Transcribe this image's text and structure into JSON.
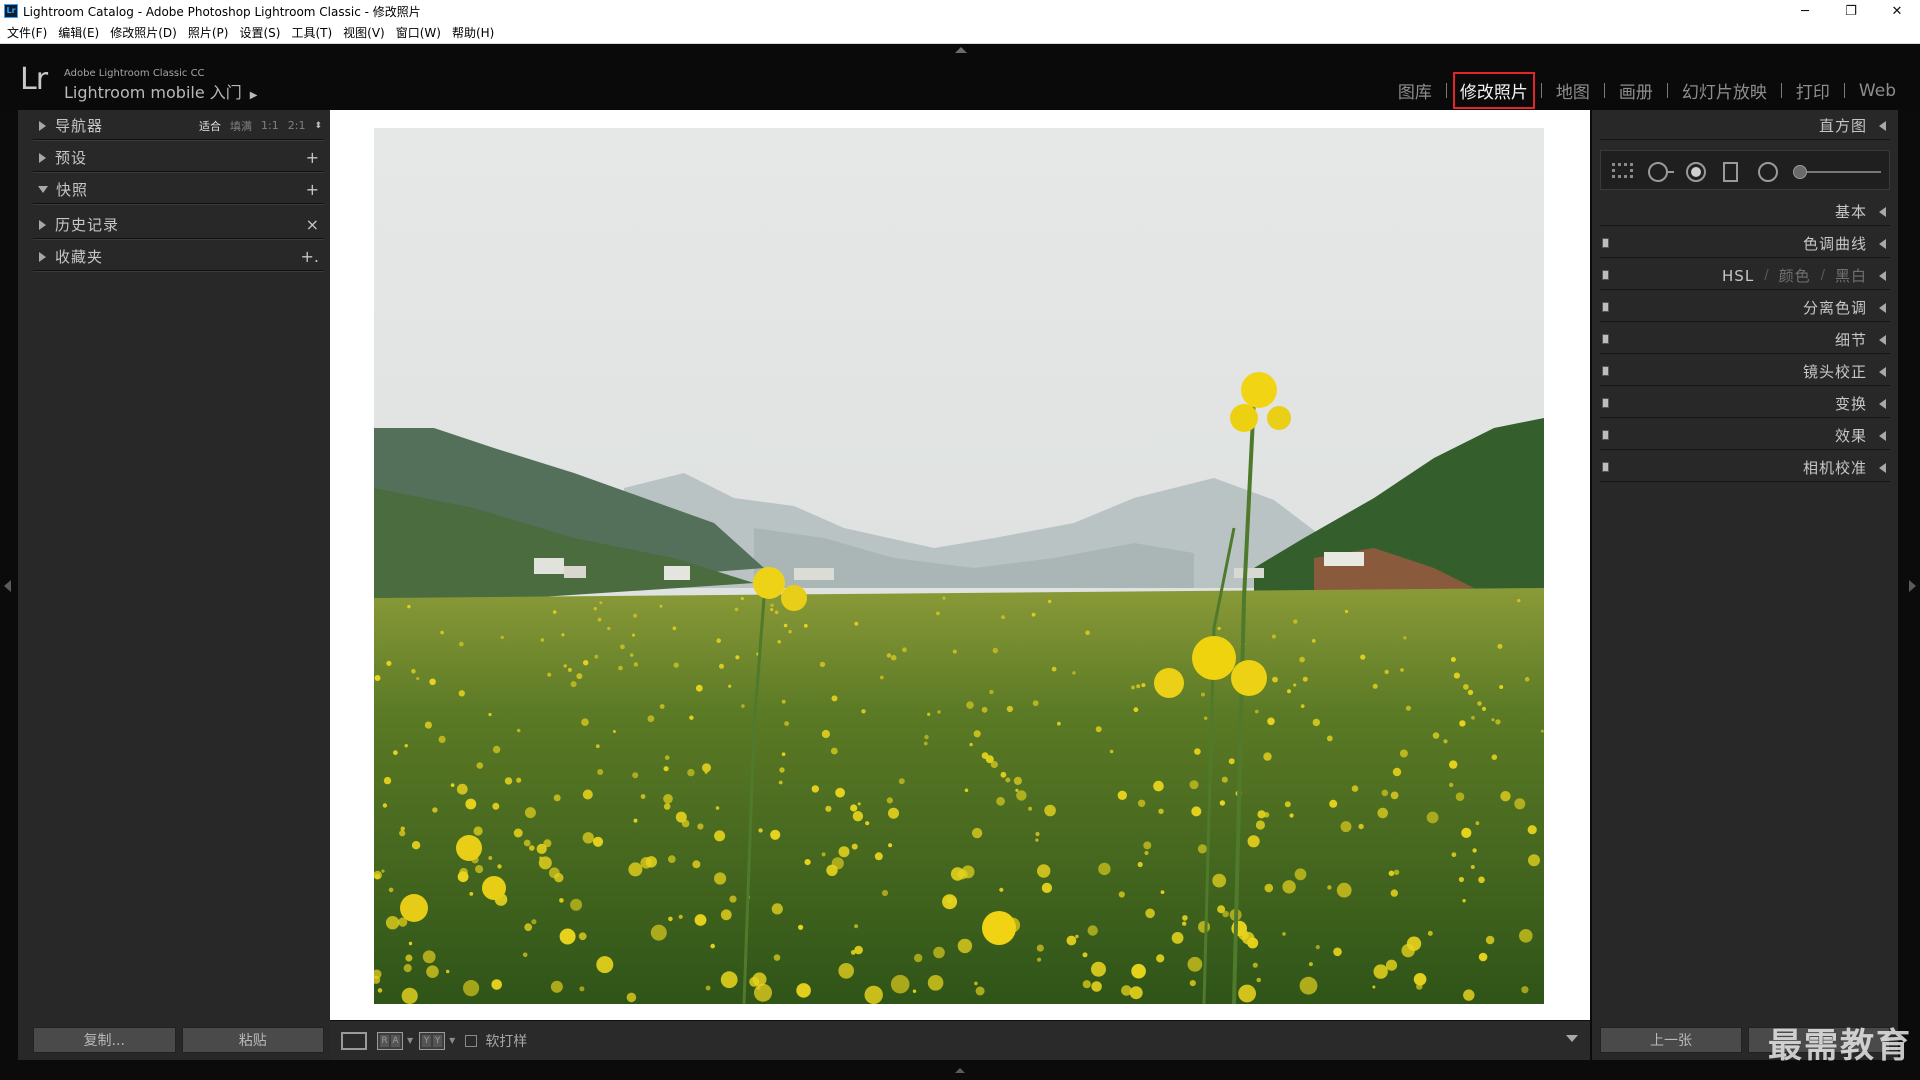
{
  "window": {
    "title": "Lightroom Catalog - Adobe Photoshop Lightroom Classic - 修改照片",
    "app_icon": "Lr",
    "controls": {
      "minimize": "─",
      "restore": "❐",
      "close": "✕"
    }
  },
  "menubar": [
    {
      "label": "文件(F)"
    },
    {
      "label": "编辑(E)"
    },
    {
      "label": "修改照片(D)"
    },
    {
      "label": "照片(P)"
    },
    {
      "label": "设置(S)"
    },
    {
      "label": "工具(T)"
    },
    {
      "label": "视图(V)"
    },
    {
      "label": "窗口(W)"
    },
    {
      "label": "帮助(H)"
    }
  ],
  "identity": {
    "logo": "Lr",
    "small": "Adobe Lightroom Classic CC",
    "mobile": "Lightroom mobile 入门",
    "arrow": "▶"
  },
  "modules": [
    {
      "label": "图库",
      "active": false
    },
    {
      "label": "修改照片",
      "active": true
    },
    {
      "label": "地图",
      "active": false
    },
    {
      "label": "画册",
      "active": false
    },
    {
      "label": "幻灯片放映",
      "active": false
    },
    {
      "label": "打印",
      "active": false
    },
    {
      "label": "Web",
      "active": false
    }
  ],
  "left_panel": {
    "navigator": {
      "title": "导航器",
      "zoom": {
        "fit": "适合",
        "fill": "填满",
        "one": "1:1",
        "two": "2:1",
        "arrows": "⬍"
      }
    },
    "presets": {
      "title": "预设",
      "action": "+"
    },
    "snapshots": {
      "title": "快照",
      "action": "+"
    },
    "history": {
      "title": "历史记录",
      "action": "×"
    },
    "collections": {
      "title": "收藏夹",
      "action": "+."
    },
    "copy_button": "复制...",
    "paste_button": "粘贴"
  },
  "toolbar": {
    "view_ra": "R",
    "view_ra2": "A",
    "view_yy": "Y",
    "view_yy2": "Y",
    "softproof_label": "软打样"
  },
  "right_panel": {
    "histogram": "直方图",
    "basic": "基本",
    "tone_curve": "色调曲线",
    "hsl": {
      "title": "HSL",
      "color": "颜色",
      "bw": "黑白",
      "sep": "/"
    },
    "split_toning": "分离色调",
    "detail": "细节",
    "lens": "镜头校正",
    "transform": "变换",
    "effects": "效果",
    "calibration": "相机校准",
    "previous_button": "上一张"
  },
  "watermark": "最需教育",
  "colors": {
    "active_module_border": "#e3242b",
    "panel_bg": "#282828",
    "background": "#0b0b0b"
  }
}
